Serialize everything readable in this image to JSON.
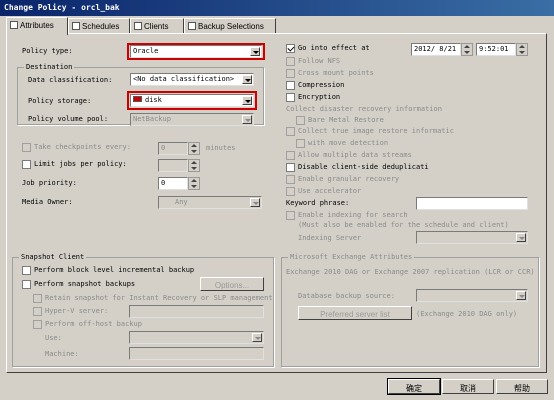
{
  "window": {
    "title": "Change Policy - orcl_bak"
  },
  "tabs": [
    {
      "label": "Attributes",
      "icon": "attributes-icon",
      "active": true
    },
    {
      "label": "Schedules",
      "icon": "schedules-icon"
    },
    {
      "label": "Clients",
      "icon": "clients-icon"
    },
    {
      "label": "Backup Selections",
      "icon": "backup-selections-icon"
    }
  ],
  "left": {
    "policy_type_label": "Policy type:",
    "policy_type_value": "Oracle",
    "destination_label": "Destination",
    "data_class_label": "Data classification:",
    "data_class_value": "<No data classification>",
    "policy_storage_label": "Policy storage:",
    "policy_storage_value": "disk",
    "volume_pool_label": "Policy volume pool:",
    "volume_pool_value": "NetBackup",
    "take_checkpoints_label": "Take checkpoints every:",
    "checkpoints_value": "0",
    "minutes_label": "minutes",
    "limit_jobs_label": "Limit jobs per policy:",
    "job_priority_label": "Job priority:",
    "job_priority_value": "0",
    "media_owner_label": "Media Owner:",
    "media_owner_value": "Any"
  },
  "right": {
    "go_into_effect_label": "Go into effect at",
    "date_value": "2012/ 8/21",
    "time_value": "9:52:01",
    "follow_nfs": "Follow NFS",
    "cross_mount": "Cross mount points",
    "compression": "Compression",
    "encryption": "Encryption",
    "collect_dr_label": "Collect disaster recovery information",
    "bare_metal": "Bare Metal Restore",
    "collect_tir": "Collect true image restore informatic",
    "move_detection": "with move detection",
    "multiple_streams": "Allow multiple data streams",
    "disable_dedup": "Disable client-side deduplicati",
    "granular": "Enable granular recovery",
    "accelerator": "Use accelerator",
    "keyword_label": "Keyword phrase:",
    "enable_indexing": "Enable indexing for search",
    "indexing_note": "(Must also be enabled for the schedule and client)",
    "indexing_server_label": "Indexing Server"
  },
  "snapshot": {
    "group_title": "Snapshot Client",
    "block_level": "Perform block level incremental backup",
    "snapshot_backups": "Perform snapshot backups",
    "options_button": "Options...",
    "retain_snapshot": "Retain snapshot for Instant Recovery or SLP management",
    "hyperv": "Hyper-V server:",
    "offhost": "Perform off-host backup",
    "use_label": "Use:",
    "machine_label": "Machine:"
  },
  "exchange": {
    "group_title": "Microsoft Exchange Attributes",
    "description": "Exchange 2010 DAG or Exchange 2007 replication (LCR or CCR)",
    "db_backup_source": "Database backup source:",
    "preferred_button": "Preferred server list",
    "dag_only": "(Exchange 2010 DAG only)"
  },
  "footer": {
    "ok": "确定",
    "cancel": "取消",
    "help": "帮助"
  },
  "colors": {
    "title_bar": "#0a246a",
    "highlight": "#cc0000",
    "face": "#d4d0c8"
  }
}
